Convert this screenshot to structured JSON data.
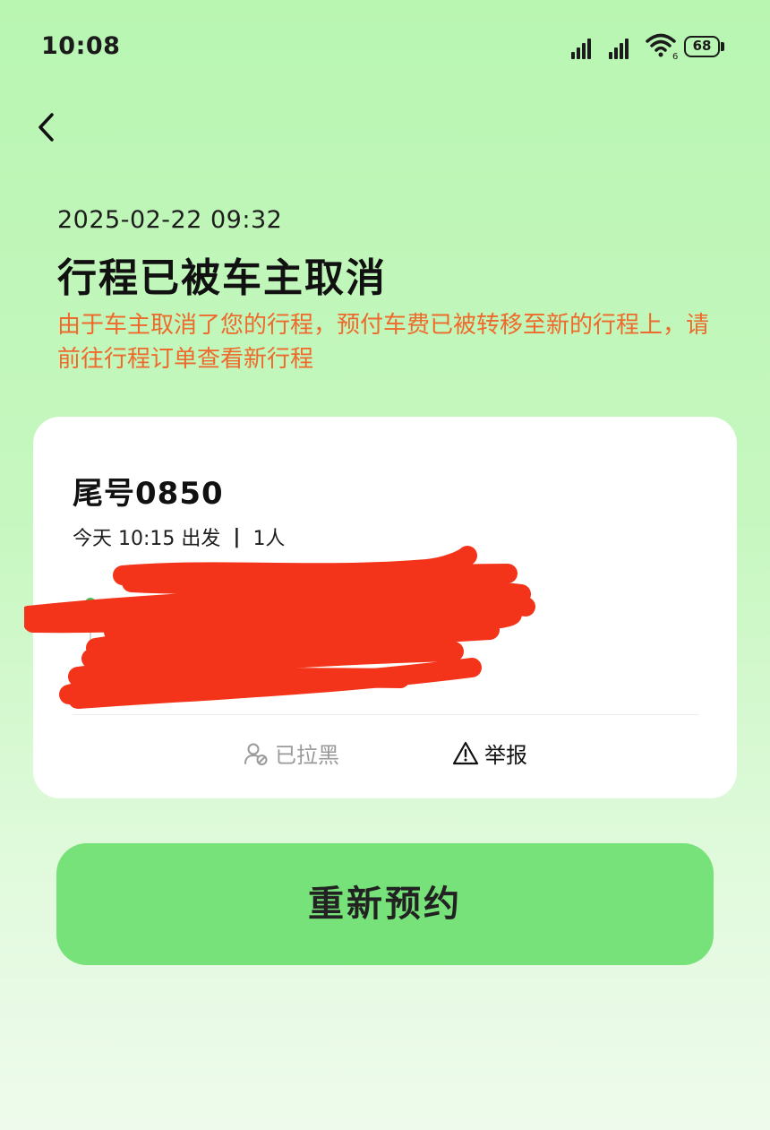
{
  "status_bar": {
    "time": "10:08",
    "battery_level": "68",
    "wifi_badge": "6",
    "icons": [
      "signal-icon",
      "signal-icon",
      "wifi-icon",
      "battery-icon"
    ]
  },
  "header": {
    "back_icon": "chevron-left-icon"
  },
  "trip_status": {
    "datetime": "2025-02-22 09:32",
    "title": "行程已被车主取消",
    "notice": "由于车主取消了您的行程，预付车费已被转移至新的行程上，请前往行程订单查看新行程"
  },
  "trip_card": {
    "plate": "尾号0850",
    "departure": "今天 10:15 出发",
    "separator": "|",
    "passengers": "1人",
    "actions": {
      "blocked_label": "已拉黑",
      "blocked_icon": "user-blocked-icon",
      "report_label": "举报",
      "report_icon": "warning-triangle-icon"
    }
  },
  "rebook_button": {
    "label": "重新预约"
  },
  "colors": {
    "notice_text": "#ee6a2c",
    "button_bg": "#77e27a",
    "scribble": "#f3341a",
    "background_top": "#b9f6b2"
  }
}
